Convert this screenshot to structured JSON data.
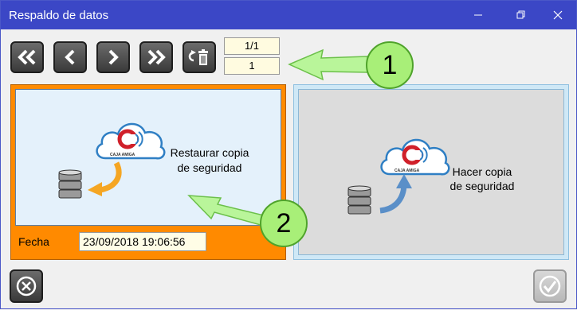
{
  "window": {
    "title": "Respaldo de datos"
  },
  "titlebar_icons": [
    "minimize-icon",
    "restore-icon",
    "close-icon"
  ],
  "toolbar": {
    "buttons": [
      "first-icon",
      "previous-icon",
      "next-icon",
      "last-icon",
      "delete-icon"
    ],
    "counter_total": "1/1",
    "counter_current": "1"
  },
  "restore_panel": {
    "label_line1": "Restaurar copia",
    "label_line2": "de seguridad",
    "logo_text": "CAJA AMIGA",
    "fecha_label": "Fecha",
    "fecha_value": "23/09/2018 19:06:56"
  },
  "backup_panel": {
    "label_line1": "Hacer copia",
    "label_line2": "de seguridad",
    "logo_text": "CAJA AMIGA"
  },
  "callouts": {
    "one": "1",
    "two": "2"
  },
  "colors": {
    "titlebar": "#3b47c6",
    "restore_frame": "#ff8a00",
    "callout": "#a8ef78"
  }
}
